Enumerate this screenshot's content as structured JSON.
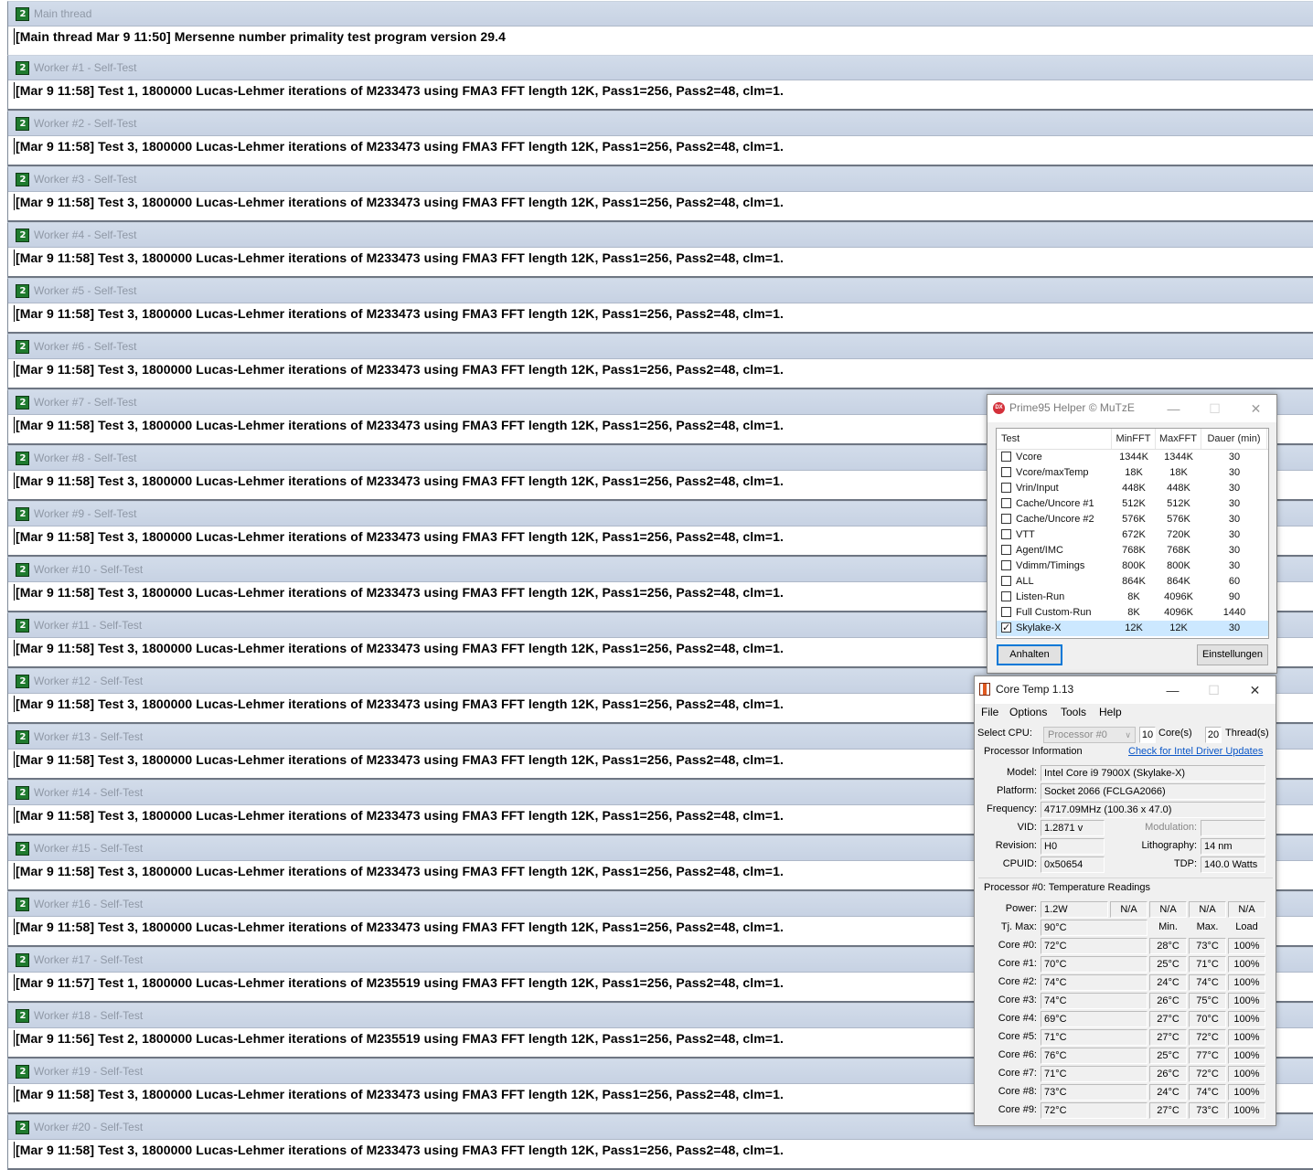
{
  "threads": [
    {
      "title": "Main thread",
      "text": "[Main thread Mar 9 11:50] Mersenne number primality test program version 29.4"
    },
    {
      "title": "Worker #1 - Self-Test",
      "text": "[Mar 9 11:58] Test 1, 1800000 Lucas-Lehmer iterations of M233473 using FMA3 FFT length 12K, Pass1=256, Pass2=48, clm=1."
    },
    {
      "title": "Worker #2 - Self-Test",
      "text": "[Mar 9 11:58] Test 3, 1800000 Lucas-Lehmer iterations of M233473 using FMA3 FFT length 12K, Pass1=256, Pass2=48, clm=1."
    },
    {
      "title": "Worker #3 - Self-Test",
      "text": "[Mar 9 11:58] Test 3, 1800000 Lucas-Lehmer iterations of M233473 using FMA3 FFT length 12K, Pass1=256, Pass2=48, clm=1."
    },
    {
      "title": "Worker #4 - Self-Test",
      "text": "[Mar 9 11:58] Test 3, 1800000 Lucas-Lehmer iterations of M233473 using FMA3 FFT length 12K, Pass1=256, Pass2=48, clm=1."
    },
    {
      "title": "Worker #5 - Self-Test",
      "text": "[Mar 9 11:58] Test 3, 1800000 Lucas-Lehmer iterations of M233473 using FMA3 FFT length 12K, Pass1=256, Pass2=48, clm=1."
    },
    {
      "title": "Worker #6 - Self-Test",
      "text": "[Mar 9 11:58] Test 3, 1800000 Lucas-Lehmer iterations of M233473 using FMA3 FFT length 12K, Pass1=256, Pass2=48, clm=1."
    },
    {
      "title": "Worker #7 - Self-Test",
      "text": "[Mar 9 11:58] Test 3, 1800000 Lucas-Lehmer iterations of M233473 using FMA3 FFT length 12K, Pass1=256, Pass2=48, clm=1."
    },
    {
      "title": "Worker #8 - Self-Test",
      "text": "[Mar 9 11:58] Test 3, 1800000 Lucas-Lehmer iterations of M233473 using FMA3 FFT length 12K, Pass1=256, Pass2=48, clm=1."
    },
    {
      "title": "Worker #9 - Self-Test",
      "text": "[Mar 9 11:58] Test 3, 1800000 Lucas-Lehmer iterations of M233473 using FMA3 FFT length 12K, Pass1=256, Pass2=48, clm=1."
    },
    {
      "title": "Worker #10 - Self-Test",
      "text": "[Mar 9 11:58] Test 3, 1800000 Lucas-Lehmer iterations of M233473 using FMA3 FFT length 12K, Pass1=256, Pass2=48, clm=1."
    },
    {
      "title": "Worker #11 - Self-Test",
      "text": "[Mar 9 11:58] Test 3, 1800000 Lucas-Lehmer iterations of M233473 using FMA3 FFT length 12K, Pass1=256, Pass2=48, clm=1."
    },
    {
      "title": "Worker #12 - Self-Test",
      "text": "[Mar 9 11:58] Test 3, 1800000 Lucas-Lehmer iterations of M233473 using FMA3 FFT length 12K, Pass1=256, Pass2=48, clm=1."
    },
    {
      "title": "Worker #13 - Self-Test",
      "text": "[Mar 9 11:58] Test 3, 1800000 Lucas-Lehmer iterations of M233473 using FMA3 FFT length 12K, Pass1=256, Pass2=48, clm=1."
    },
    {
      "title": "Worker #14 - Self-Test",
      "text": "[Mar 9 11:58] Test 3, 1800000 Lucas-Lehmer iterations of M233473 using FMA3 FFT length 12K, Pass1=256, Pass2=48, clm=1."
    },
    {
      "title": "Worker #15 - Self-Test",
      "text": "[Mar 9 11:58] Test 3, 1800000 Lucas-Lehmer iterations of M233473 using FMA3 FFT length 12K, Pass1=256, Pass2=48, clm=1."
    },
    {
      "title": "Worker #16 - Self-Test",
      "text": "[Mar 9 11:58] Test 3, 1800000 Lucas-Lehmer iterations of M233473 using FMA3 FFT length 12K, Pass1=256, Pass2=48, clm=1."
    },
    {
      "title": "Worker #17 - Self-Test",
      "text": "[Mar 9 11:57] Test 1, 1800000 Lucas-Lehmer iterations of M235519 using FMA3 FFT length 12K, Pass1=256, Pass2=48, clm=1."
    },
    {
      "title": "Worker #18 - Self-Test",
      "text": "[Mar 9 11:56] Test 2, 1800000 Lucas-Lehmer iterations of M235519 using FMA3 FFT length 12K, Pass1=256, Pass2=48, clm=1."
    },
    {
      "title": "Worker #19 - Self-Test",
      "text": "[Mar 9 11:58] Test 3, 1800000 Lucas-Lehmer iterations of M233473 using FMA3 FFT length 12K, Pass1=256, Pass2=48, clm=1."
    },
    {
      "title": "Worker #20 - Self-Test",
      "text": "[Mar 9 11:58] Test 3, 1800000 Lucas-Lehmer iterations of M233473 using FMA3 FFT length 12K, Pass1=256, Pass2=48, clm=1."
    }
  ],
  "thread_icon_text": "2",
  "helper": {
    "icon_text": "DX",
    "title": "Prime95 Helper © MuTzE",
    "columns": [
      "Test",
      "MinFFT",
      "MaxFFT",
      "Dauer (min)"
    ],
    "rows": [
      {
        "test": "Vcore",
        "min": "1344K",
        "max": "1344K",
        "dur": "30",
        "checked": false
      },
      {
        "test": "Vcore/maxTemp",
        "min": "18K",
        "max": "18K",
        "dur": "30",
        "checked": false
      },
      {
        "test": "Vrin/Input",
        "min": "448K",
        "max": "448K",
        "dur": "30",
        "checked": false
      },
      {
        "test": "Cache/Uncore #1",
        "min": "512K",
        "max": "512K",
        "dur": "30",
        "checked": false
      },
      {
        "test": "Cache/Uncore #2",
        "min": "576K",
        "max": "576K",
        "dur": "30",
        "checked": false
      },
      {
        "test": "VTT",
        "min": "672K",
        "max": "720K",
        "dur": "30",
        "checked": false
      },
      {
        "test": "Agent/IMC",
        "min": "768K",
        "max": "768K",
        "dur": "30",
        "checked": false
      },
      {
        "test": "Vdimm/Timings",
        "min": "800K",
        "max": "800K",
        "dur": "30",
        "checked": false
      },
      {
        "test": "ALL",
        "min": "864K",
        "max": "864K",
        "dur": "60",
        "checked": false
      },
      {
        "test": "Listen-Run",
        "min": "8K",
        "max": "4096K",
        "dur": "90",
        "checked": false
      },
      {
        "test": "Full Custom-Run",
        "min": "8K",
        "max": "4096K",
        "dur": "1440",
        "checked": false
      },
      {
        "test": "Skylake-X",
        "min": "12K",
        "max": "12K",
        "dur": "30",
        "checked": true
      }
    ],
    "btn_stop": "Anhalten",
    "btn_settings": "Einstellungen"
  },
  "coretemp": {
    "title": "Core Temp 1.13",
    "menu": [
      "File",
      "Options",
      "Tools",
      "Help"
    ],
    "select_cpu_label": "Select CPU:",
    "select_cpu_value": "Processor #0",
    "cores_value": "10",
    "cores_label": "Core(s)",
    "threads_value": "20",
    "threads_label": "Thread(s)",
    "proc_info_label": "Processor Information",
    "driver_link": "Check for Intel Driver Updates",
    "model_label": "Model:",
    "model": "Intel Core i9 7900X (Skylake-X)",
    "platform_label": "Platform:",
    "platform": "Socket 2066 (FCLGA2066)",
    "frequency_label": "Frequency:",
    "frequency": "4717.09MHz (100.36 x 47.0)",
    "vid_label": "VID:",
    "vid": "1.2871 v",
    "modulation_label": "Modulation:",
    "modulation": "",
    "revision_label": "Revision:",
    "revision": "H0",
    "lithography_label": "Lithography:",
    "lithography": "14 nm",
    "cpuid_label": "CPUID:",
    "cpuid": "0x50654",
    "tdp_label": "TDP:",
    "tdp": "140.0 Watts",
    "temp_label": "Processor #0: Temperature Readings",
    "power_label": "Power:",
    "power": [
      "1.2W",
      "N/A",
      "N/A",
      "N/A",
      "N/A"
    ],
    "tjmax_label": "Tj. Max:",
    "tjmax": "90°C",
    "col_min": "Min.",
    "col_max": "Max.",
    "col_load": "Load",
    "cores": [
      {
        "name": "Core #0:",
        "temp": "72°C",
        "min": "28°C",
        "max": "73°C",
        "load": "100%"
      },
      {
        "name": "Core #1:",
        "temp": "70°C",
        "min": "25°C",
        "max": "71°C",
        "load": "100%"
      },
      {
        "name": "Core #2:",
        "temp": "74°C",
        "min": "24°C",
        "max": "74°C",
        "load": "100%"
      },
      {
        "name": "Core #3:",
        "temp": "74°C",
        "min": "26°C",
        "max": "75°C",
        "load": "100%"
      },
      {
        "name": "Core #4:",
        "temp": "69°C",
        "min": "27°C",
        "max": "70°C",
        "load": "100%"
      },
      {
        "name": "Core #5:",
        "temp": "71°C",
        "min": "27°C",
        "max": "72°C",
        "load": "100%"
      },
      {
        "name": "Core #6:",
        "temp": "76°C",
        "min": "25°C",
        "max": "77°C",
        "load": "100%"
      },
      {
        "name": "Core #7:",
        "temp": "71°C",
        "min": "26°C",
        "max": "72°C",
        "load": "100%"
      },
      {
        "name": "Core #8:",
        "temp": "73°C",
        "min": "24°C",
        "max": "74°C",
        "load": "100%"
      },
      {
        "name": "Core #9:",
        "temp": "72°C",
        "min": "27°C",
        "max": "73°C",
        "load": "100%"
      }
    ]
  }
}
